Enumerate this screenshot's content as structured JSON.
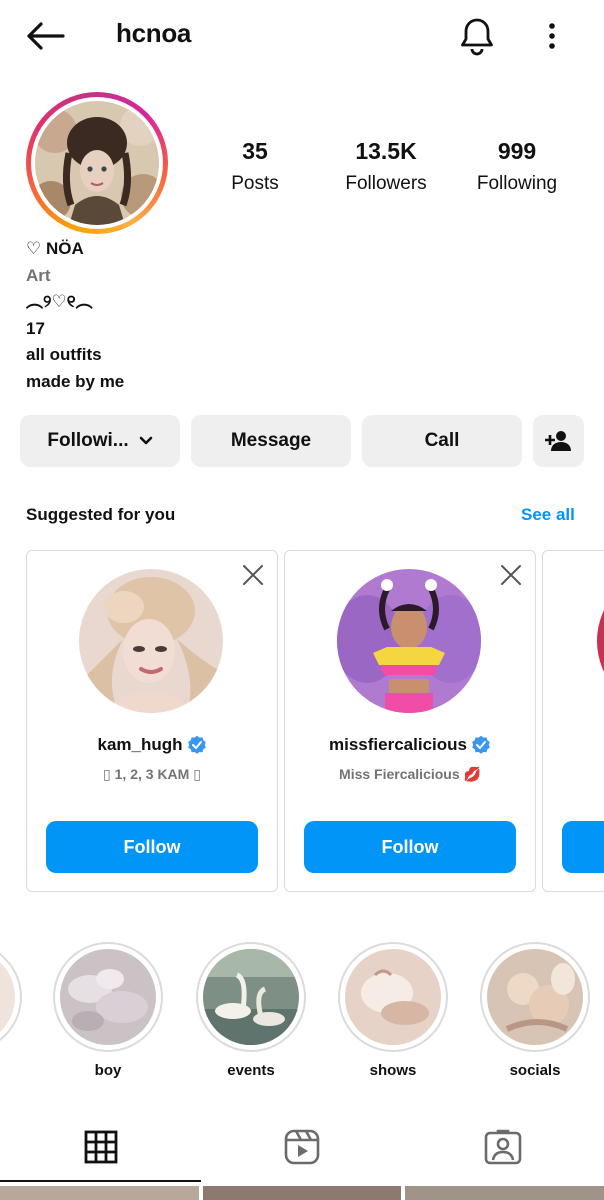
{
  "header": {
    "username": "hcnoa",
    "icons": [
      "back-arrow-icon",
      "bell-icon",
      "more-vertical-icon"
    ]
  },
  "stats": {
    "posts": {
      "value": "35",
      "label": "Posts"
    },
    "followers": {
      "value": "13.5K",
      "label": "Followers"
    },
    "following": {
      "value": "999",
      "label": "Following"
    }
  },
  "bio": {
    "name": "♡ NÖA",
    "category": "Art",
    "line1": "︵୨♡୧︵",
    "line2": "17",
    "line3": "all outfits",
    "line4": "made by me"
  },
  "actions": {
    "following_label": "Followi...",
    "message_label": "Message",
    "call_label": "Call"
  },
  "suggested": {
    "title": "Suggested for you",
    "see_all": "See all",
    "cards": [
      {
        "username": "kam_hugh",
        "subtitle": "▯ 1, 2, 3 KAM ▯",
        "follow_label": "Follow"
      },
      {
        "username": "missfiercalicious",
        "subtitle": "Miss Fiercalicious 💋",
        "follow_label": "Follow"
      }
    ]
  },
  "highlights": [
    {
      "label": "boy"
    },
    {
      "label": "events"
    },
    {
      "label": "shows"
    },
    {
      "label": "socials"
    }
  ],
  "tabs": [
    "grid-icon",
    "reels-icon",
    "tagged-icon"
  ],
  "colors": {
    "accent": "#0095f6",
    "button_bg": "#efefef",
    "muted_text": "#737373",
    "verified": "#3897f0"
  }
}
